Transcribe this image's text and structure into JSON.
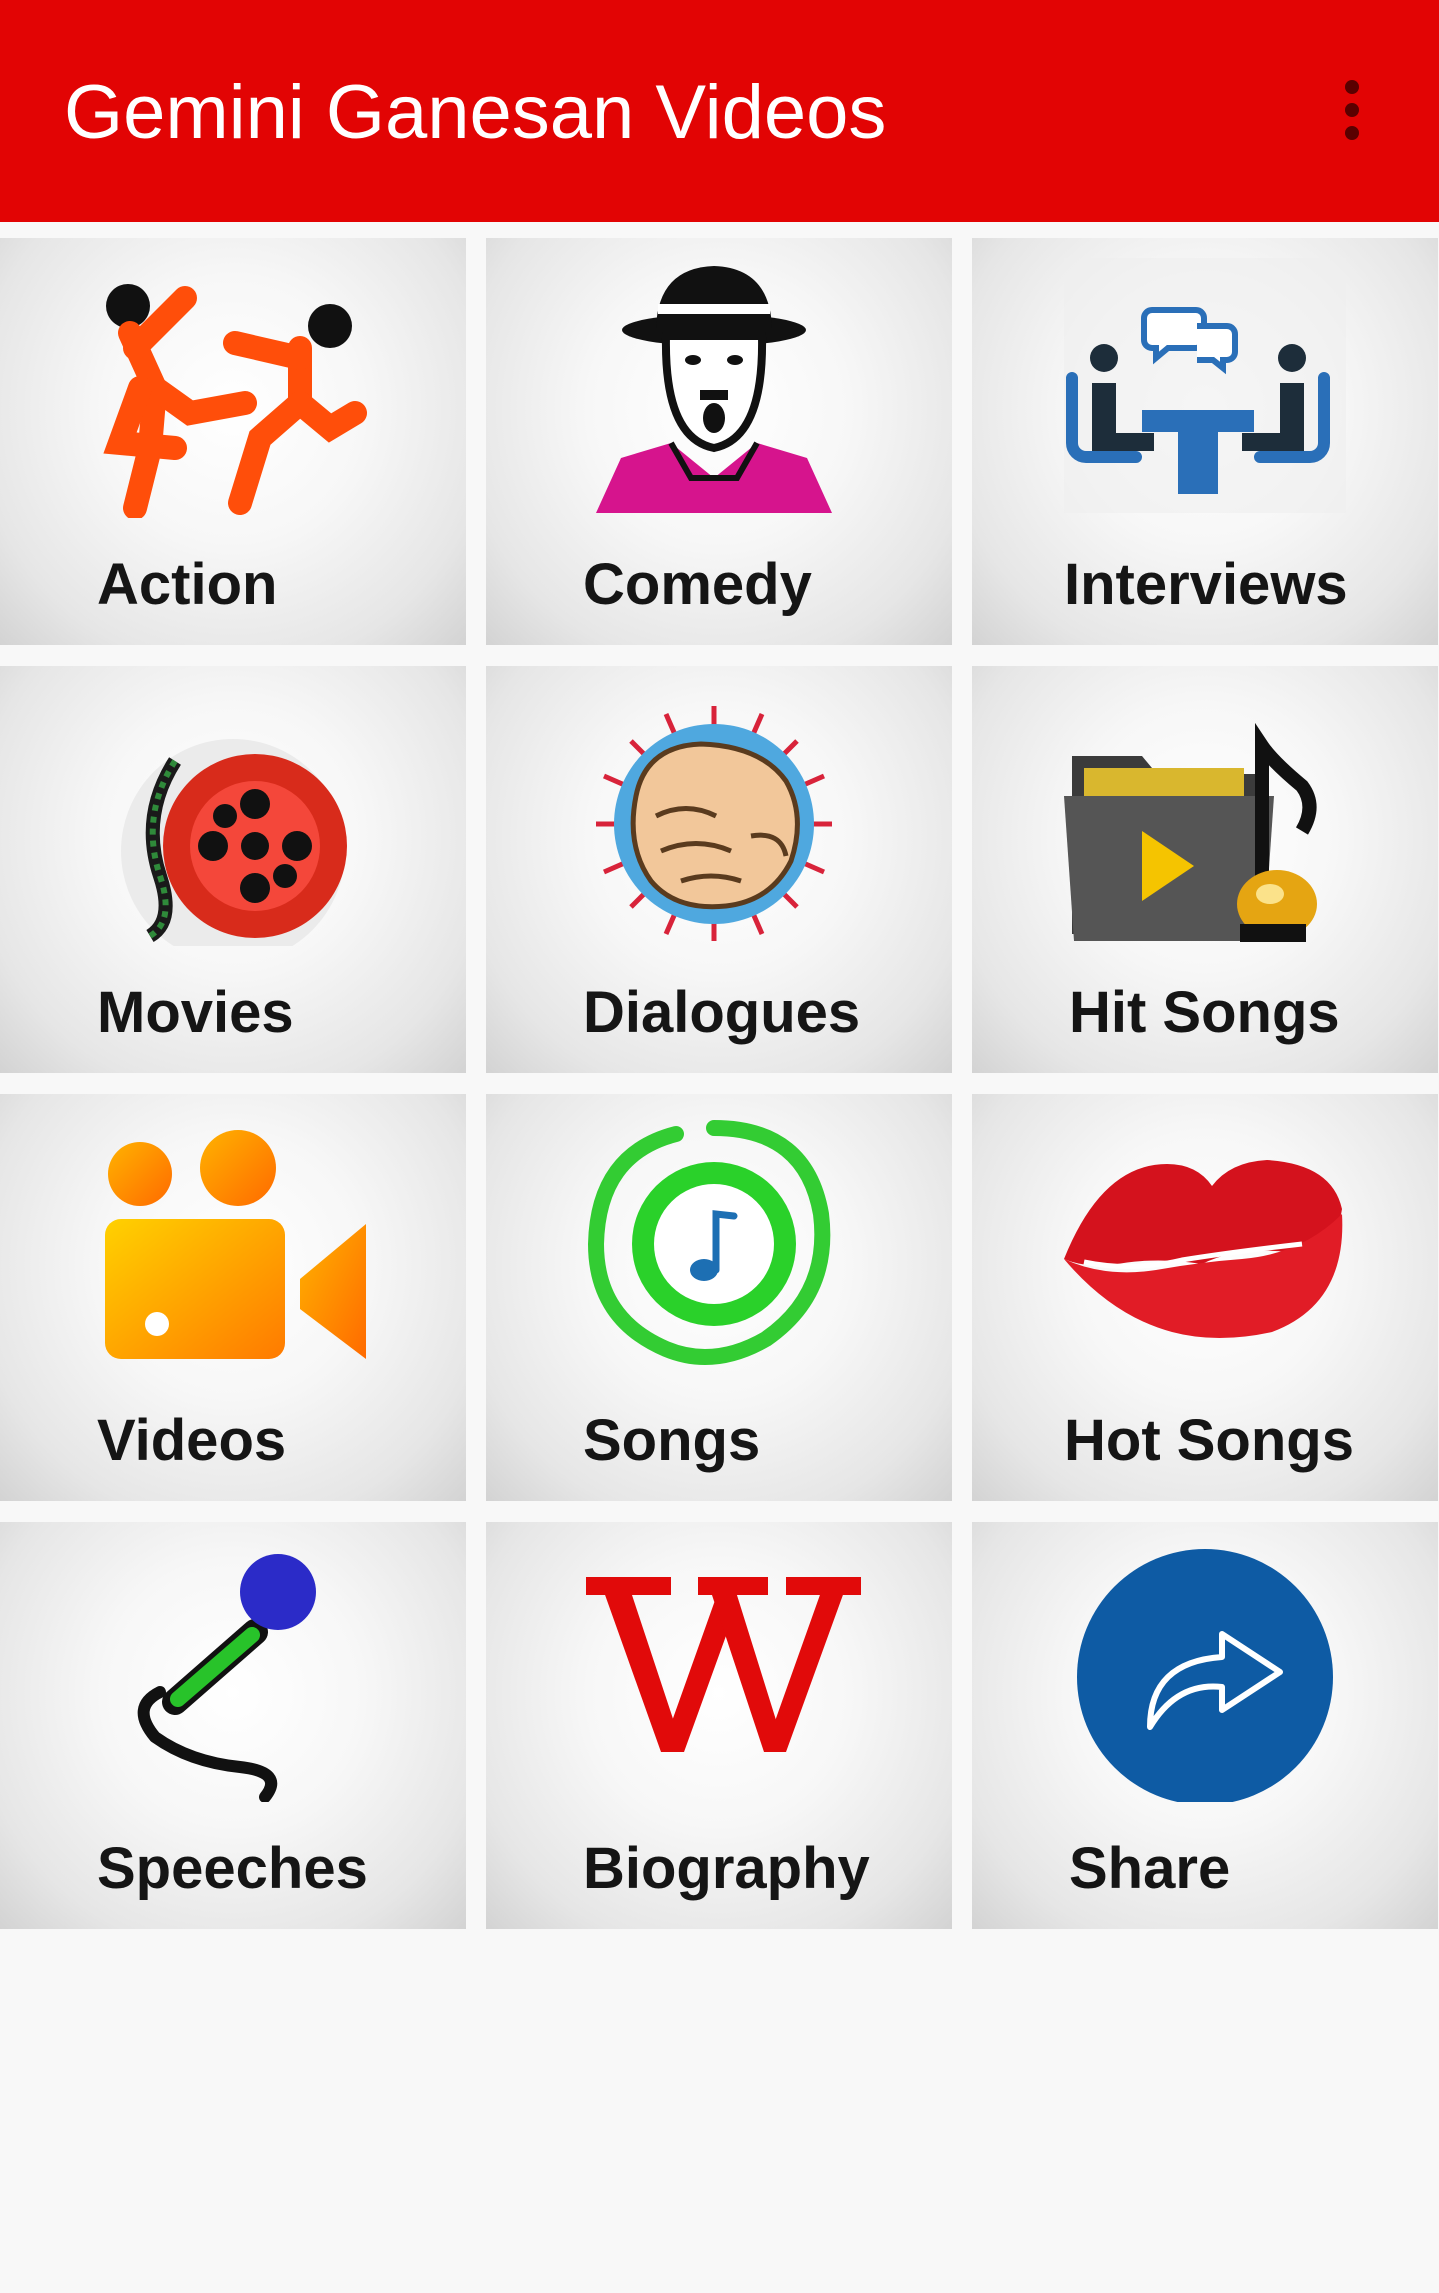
{
  "app_bar": {
    "title": "Gemini Ganesan Videos",
    "overflow_icon": "more-vert-icon",
    "background": "#e20404"
  },
  "tiles": [
    {
      "label": "Action",
      "icon": "kick-fight-icon"
    },
    {
      "label": "Comedy",
      "icon": "clown-face-icon"
    },
    {
      "label": "Interviews",
      "icon": "interview-table-icon"
    },
    {
      "label": "Movies",
      "icon": "film-reel-icon"
    },
    {
      "label": "Dialogues",
      "icon": "fist-punch-icon"
    },
    {
      "label": "Hit Songs",
      "icon": "music-folder-icon"
    },
    {
      "label": "Videos",
      "icon": "video-camera-icon"
    },
    {
      "label": "Songs",
      "icon": "music-note-circle-icon"
    },
    {
      "label": "Hot Songs",
      "icon": "lips-icon"
    },
    {
      "label": "Speeches",
      "icon": "microphone-icon"
    },
    {
      "label": "Biography",
      "icon": "wikipedia-icon"
    },
    {
      "label": "Share",
      "icon": "share-icon"
    }
  ]
}
